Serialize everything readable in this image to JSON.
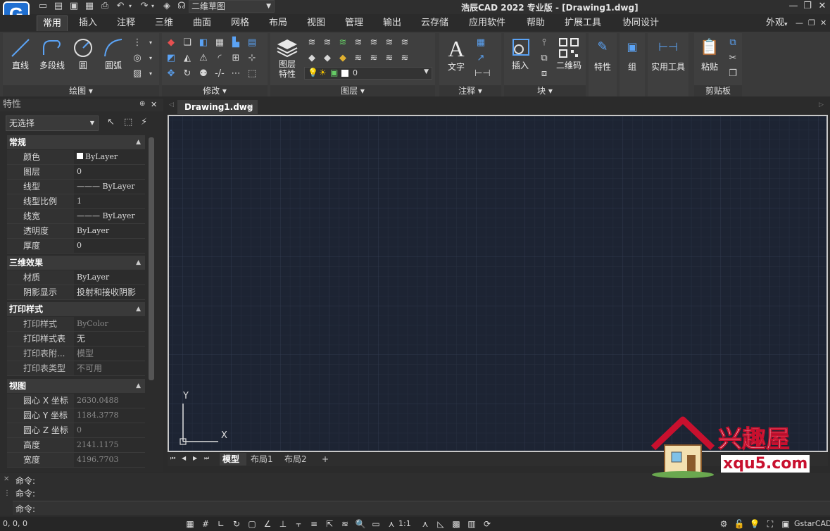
{
  "titlebar": {
    "title": "浩辰CAD 2022 专业版 - [Drawing1.dwg]",
    "workspace": "二维草图",
    "logo_letter": "G"
  },
  "menu": {
    "tabs": [
      "常用",
      "插入",
      "注释",
      "三维",
      "曲面",
      "网格",
      "布局",
      "视图",
      "管理",
      "输出",
      "云存储",
      "应用软件",
      "帮助",
      "扩展工具",
      "协同设计"
    ],
    "appearance": "外观"
  },
  "ribbon": {
    "draw": {
      "label": "绘图",
      "line": "直线",
      "polyline": "多段线",
      "circle": "圆",
      "arc": "圆弧"
    },
    "modify": {
      "label": "修改"
    },
    "layers": {
      "label": "图层",
      "layer_props": "图层\n特性",
      "current_layer": "0"
    },
    "annotate": {
      "label": "注释",
      "text": "文字"
    },
    "block": {
      "label": "块",
      "insert": "插入",
      "qrcode": "二维码"
    },
    "properties": {
      "label": "特性"
    },
    "group": {
      "label": "组"
    },
    "utilities": {
      "label": "实用工具"
    },
    "clipboard": {
      "label": "剪贴板",
      "paste": "粘贴"
    }
  },
  "properties": {
    "title": "特性",
    "selection": "无选择",
    "general": {
      "header": "常规",
      "rows": [
        {
          "k": "颜色",
          "v": "ByLayer"
        },
        {
          "k": "图层",
          "v": "0"
        },
        {
          "k": "线型",
          "v": "——— ByLayer"
        },
        {
          "k": "线型比例",
          "v": "1"
        },
        {
          "k": "线宽",
          "v": "——— ByLayer"
        },
        {
          "k": "透明度",
          "v": "ByLayer"
        },
        {
          "k": "厚度",
          "v": "0"
        }
      ]
    },
    "threed": {
      "header": "三维效果",
      "rows": [
        {
          "k": "材质",
          "v": "ByLayer"
        },
        {
          "k": "阴影显示",
          "v": "投射和接收阴影"
        }
      ]
    },
    "plot": {
      "header": "打印样式",
      "rows": [
        {
          "k": "打印样式",
          "v": "ByColor"
        },
        {
          "k": "打印样式表",
          "v": "无"
        },
        {
          "k": "打印表附...",
          "v": "模型"
        },
        {
          "k": "打印表类型",
          "v": "不可用"
        }
      ]
    },
    "view": {
      "header": "视图",
      "rows": [
        {
          "k": "圆心 X 坐标",
          "v": "2630.0488"
        },
        {
          "k": "圆心 Y 坐标",
          "v": "1184.3778"
        },
        {
          "k": "圆心 Z 坐标",
          "v": "0"
        },
        {
          "k": "高度",
          "v": "2141.1175"
        },
        {
          "k": "宽度",
          "v": "4196.7703"
        }
      ]
    }
  },
  "document": {
    "tab": "Drawing1.dwg",
    "ucs_x": "X",
    "ucs_y": "Y",
    "layout_tabs": [
      "模型",
      "布局1",
      "布局2",
      "+"
    ]
  },
  "command": {
    "lines": [
      "命令:",
      "命令:",
      "命令:"
    ]
  },
  "status": {
    "coords": "0, 0, 0",
    "scale": "1:1",
    "brand": "GstarCAD"
  },
  "watermark": {
    "title": "兴趣屋",
    "url": "xqu5.com"
  }
}
